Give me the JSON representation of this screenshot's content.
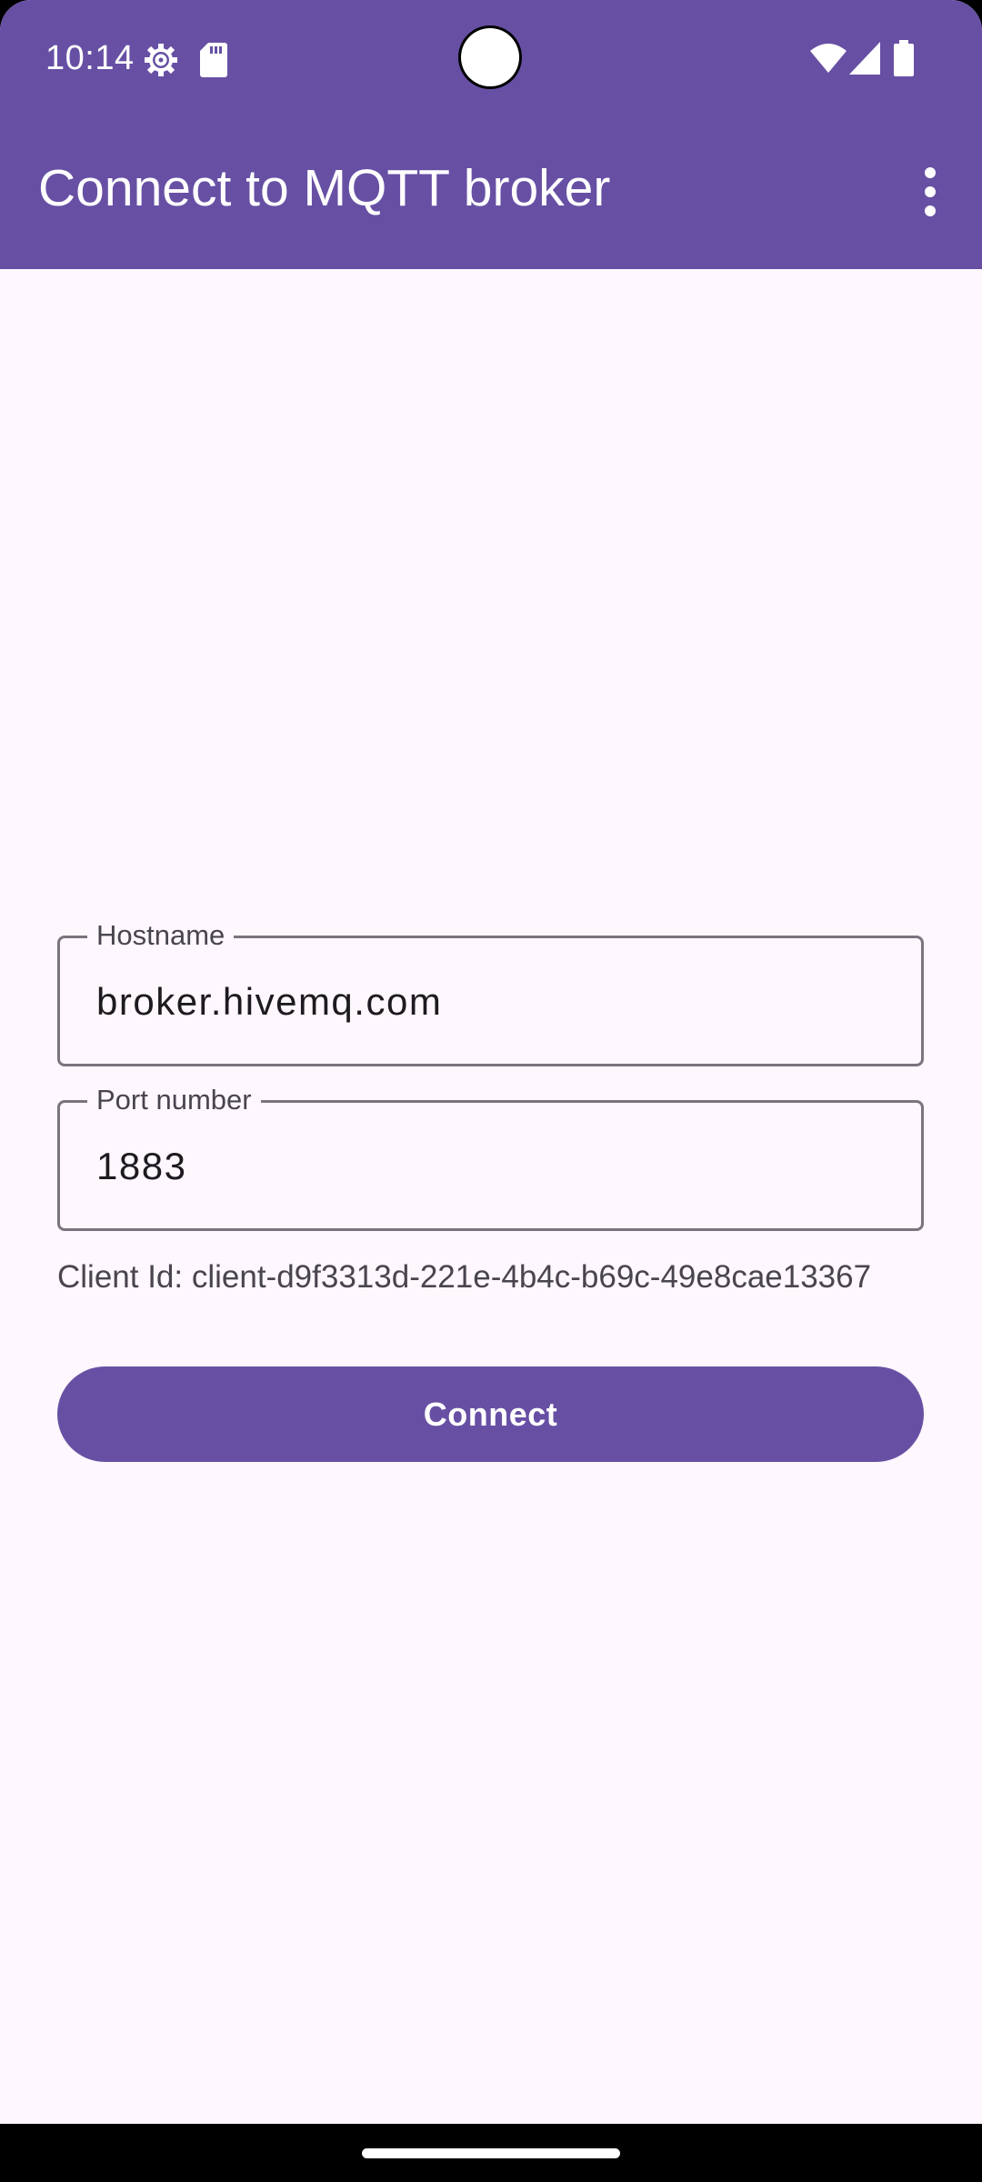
{
  "status_bar": {
    "time": "10:14",
    "icons": [
      "settings-gear-icon",
      "sd-card-icon",
      "wifi-icon",
      "cellular-signal-icon",
      "battery-icon"
    ]
  },
  "app_bar": {
    "title": "Connect to MQTT broker",
    "menu_icon": "more-vert-icon"
  },
  "form": {
    "hostname": {
      "label": "Hostname",
      "value": "broker.hivemq.com"
    },
    "port": {
      "label": "Port number",
      "value": "1883"
    },
    "client_id": "Client Id: client-d9f3313d-221e-4b4c-b69c-49e8cae13367",
    "connect_label": "Connect"
  },
  "colors": {
    "primary": "#6750A4",
    "background": "#FEF7FD",
    "outline": "#79747E",
    "on_primary": "#FFFFFF"
  }
}
